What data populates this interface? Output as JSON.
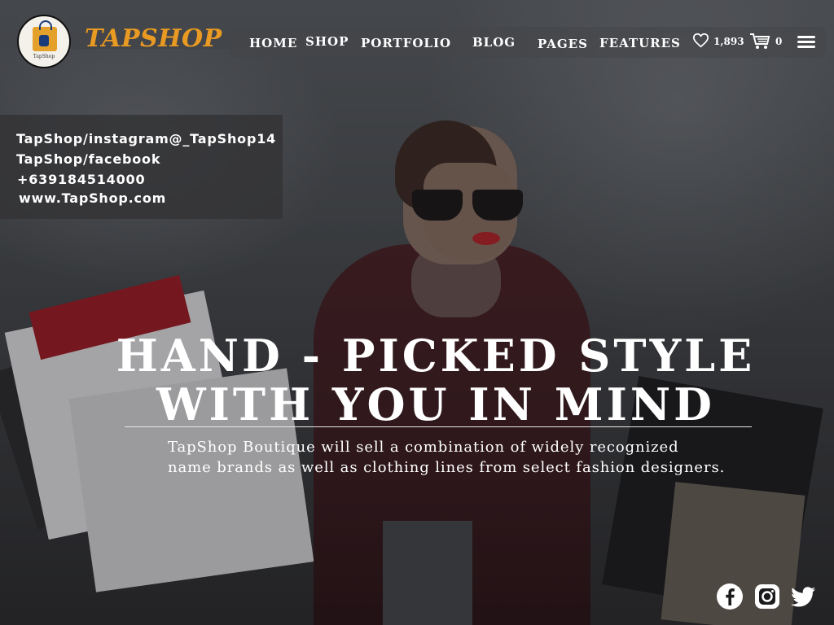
{
  "brand": {
    "name": "TAPSHOP",
    "logo_caption": "TapShop"
  },
  "nav": {
    "items": [
      {
        "label": "HOME"
      },
      {
        "label": "SHOP"
      },
      {
        "label": "PORTFOLIO"
      },
      {
        "label": "BLOG"
      },
      {
        "label": "PAGES"
      },
      {
        "label": "FEATURES"
      }
    ],
    "wishlist_count": "1,893",
    "cart_count": "0",
    "icons": [
      "heart-icon",
      "cart-icon",
      "menu-icon"
    ]
  },
  "contact": {
    "instagram": "TapShop/instagram@_TapShop14",
    "facebook": "TapShop/facebook",
    "phone": "+639184514000",
    "website": "www.TapShop.com"
  },
  "hero": {
    "title_line1": "HAND - PICKED STYLE",
    "title_line2": "WITH YOU IN MIND",
    "subtitle_line1": "TapShop Boutique will sell a combination of widely recognized",
    "subtitle_line2": "name brands as well as clothing lines from select fashion designers."
  },
  "social": {
    "icons": [
      "facebook-icon",
      "instagram-icon",
      "twitter-icon"
    ]
  },
  "colors": {
    "brand": "#e99a23",
    "text": "#ffffff",
    "panel": "#343436",
    "lips": "#b82228"
  }
}
